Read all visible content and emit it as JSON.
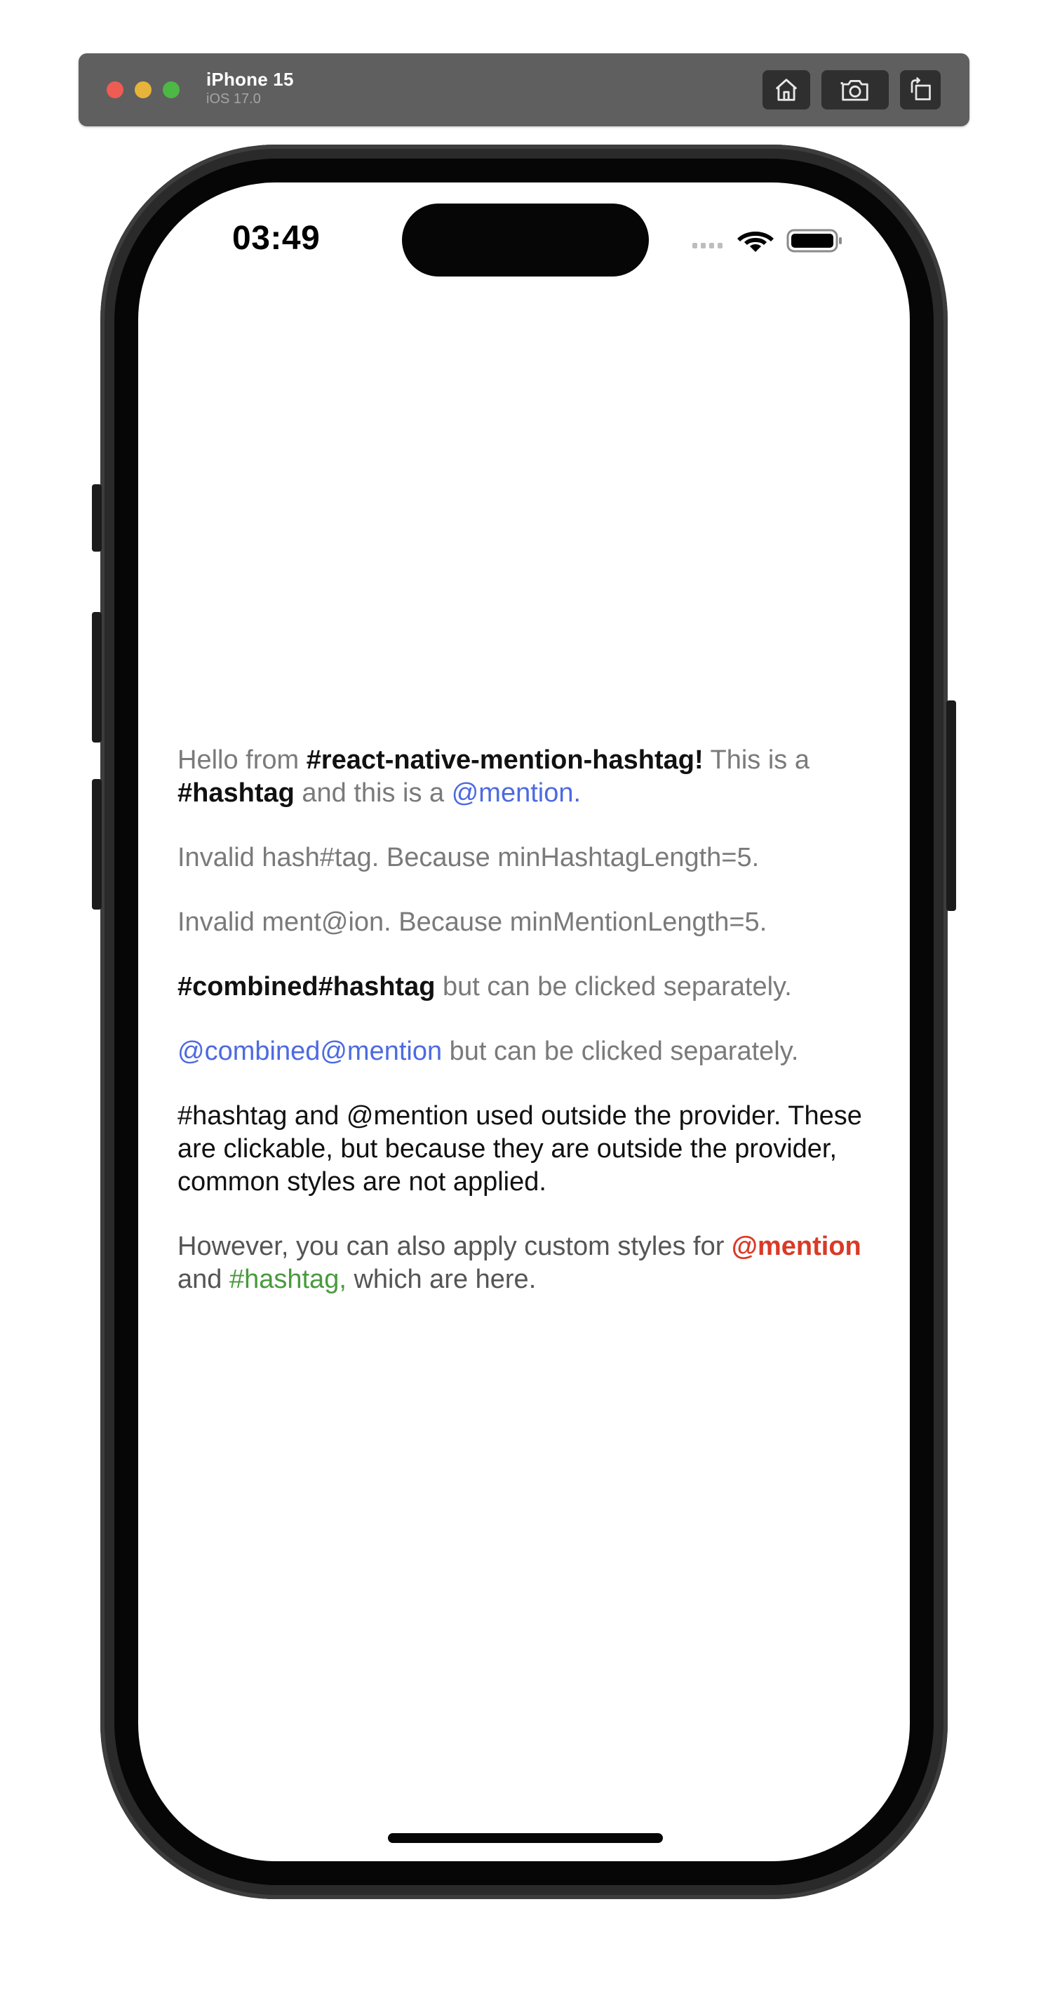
{
  "simulator": {
    "device_name": "iPhone 15",
    "os_version": "iOS 17.0",
    "buttons": [
      "home-icon",
      "screenshot-icon",
      "rotate-icon"
    ]
  },
  "status_bar": {
    "time": "03:49",
    "icons": [
      "cellular-icon",
      "wifi-icon",
      "battery-icon"
    ]
  },
  "content": {
    "para1": {
      "text1": "Hello from ",
      "tag1": "#react-native-mention-hashtag!",
      "text2": " This is a ",
      "tag2": "#hashtag",
      "text3": " and this is a ",
      "mention1": "@mention."
    },
    "para2": {
      "text": "Invalid hash#tag. Because minHashtagLength=5."
    },
    "para3": {
      "text": "Invalid ment@ion. Because minMentionLength=5."
    },
    "para4": {
      "tag": "#combined#hashtag",
      "text": " but can be clicked separately."
    },
    "para5": {
      "mention": "@combined@mention",
      "text": " but can be clicked separately."
    },
    "para6": {
      "tag": "#hashtag",
      "text1": " and ",
      "mention": "@mention",
      "text2": " used outside the provider. These are clickable, but because they are outside the provider, common styles are not applied."
    },
    "para7": {
      "text1": "However, you can also apply custom styles for ",
      "mention": "@mention",
      "text2": " and ",
      "tag": "#hashtag,",
      "text3": " which are here."
    }
  },
  "colors": {
    "mention_blue": "#4d6ae0",
    "custom_mention_red": "#d93a26",
    "custom_hashtag_green": "#4a9a3e",
    "secondary_text_grey": "#7a7a7a"
  }
}
